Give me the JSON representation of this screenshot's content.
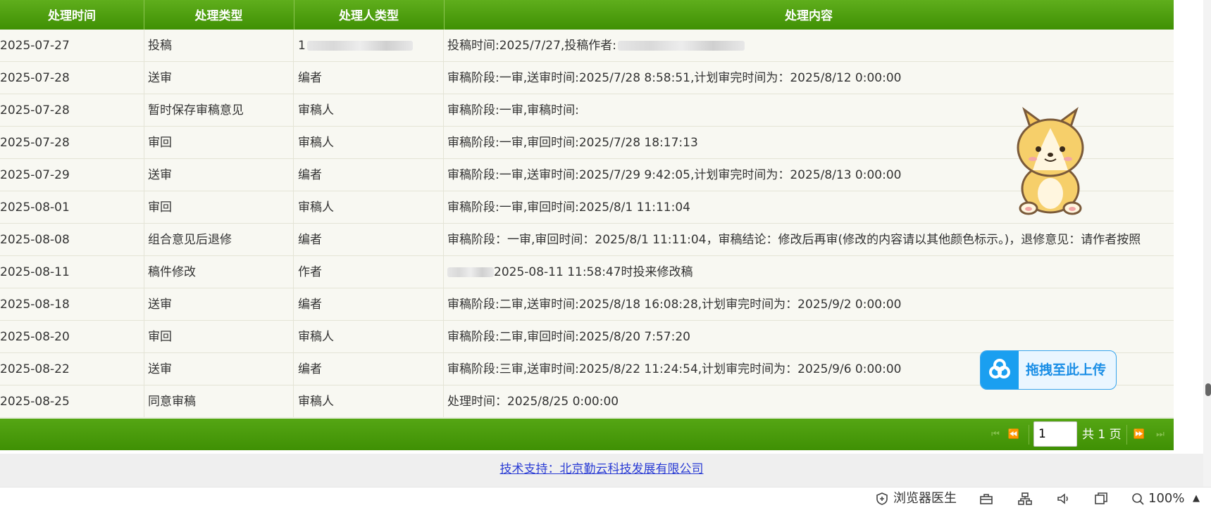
{
  "table": {
    "headers": [
      "处理时间",
      "处理类型",
      "处理人类型",
      "处理内容"
    ],
    "rows": [
      {
        "date": "2025-07-27",
        "type": "投稿",
        "handler": "1",
        "content": "投稿时间:2025/7/27,投稿作者:"
      },
      {
        "date": "2025-07-28",
        "type": "送审",
        "handler": "编者",
        "content": "审稿阶段:一审,送审时间:2025/7/28 8:58:51,计划审完时间为：2025/8/12 0:00:00"
      },
      {
        "date": "2025-07-28",
        "type": "暂时保存审稿意见",
        "handler": "审稿人",
        "content": "审稿阶段:一审,审稿时间:"
      },
      {
        "date": "2025-07-28",
        "type": "审回",
        "handler": "审稿人",
        "content": "审稿阶段:一审,审回时间:2025/7/28 18:17:13"
      },
      {
        "date": "2025-07-29",
        "type": "送审",
        "handler": "编者",
        "content": "审稿阶段:一审,送审时间:2025/7/29 9:42:05,计划审完时间为：2025/8/13 0:00:00"
      },
      {
        "date": "2025-08-01",
        "type": "审回",
        "handler": "审稿人",
        "content": "审稿阶段:一审,审回时间:2025/8/1 11:11:04"
      },
      {
        "date": "2025-08-08",
        "type": "组合意见后退修",
        "handler": "编者",
        "content": "审稿阶段：一审,审回时间：2025/8/1 11:11:04，审稿结论：修改后再审(修改的内容请以其他颜色标示。)，退修意见：请作者按照"
      },
      {
        "date": "2025-08-11",
        "type": "稿件修改",
        "handler": "作者",
        "content": "2025-08-11 11:58:47时投来修改稿"
      },
      {
        "date": "2025-08-18",
        "type": "送审",
        "handler": "编者",
        "content": "审稿阶段:二审,送审时间:2025/8/18 16:08:28,计划审完时间为：2025/9/2 0:00:00"
      },
      {
        "date": "2025-08-20",
        "type": "审回",
        "handler": "审稿人",
        "content": "审稿阶段:二审,审回时间:2025/8/20 7:57:20"
      },
      {
        "date": "2025-08-22",
        "type": "送审",
        "handler": "编者",
        "content": "审稿阶段:三审,送审时间:2025/8/22 11:24:54,计划审完时间为：2025/9/6 0:00:00"
      },
      {
        "date": "2025-08-25",
        "type": "同意审稿",
        "handler": "审稿人",
        "content": "处理时间：2025/8/25 0:00:00"
      }
    ]
  },
  "pager": {
    "page_value": "1",
    "total_label": "共 1 页"
  },
  "footer": {
    "link": "技术支持：北京勤云科技发展有限公司"
  },
  "upload": {
    "label": "拖拽至此上传"
  },
  "statusbar": {
    "doctor_label": "浏览器医生",
    "zoom": "100%"
  },
  "colors": {
    "header_green": "#4a9a0c",
    "row_bg": "#f8f8f2",
    "link": "#2a3cd4",
    "upload_blue": "#1a9ff0"
  }
}
